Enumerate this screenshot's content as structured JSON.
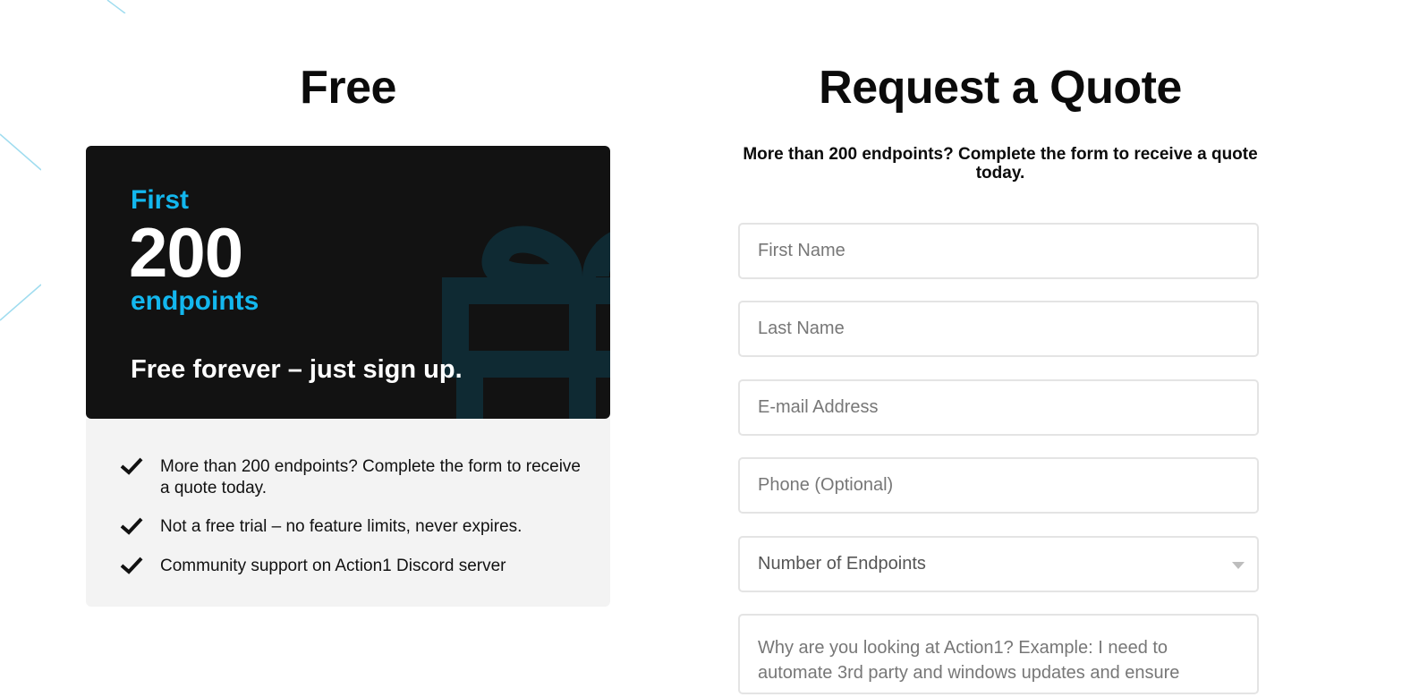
{
  "free": {
    "title": "Free",
    "promo": {
      "first": "First",
      "number": "200",
      "unit": "endpoints",
      "tagline": "Free forever – just sign up."
    },
    "features": [
      "More than 200 endpoints? Complete the form to receive a quote today.",
      "Not a free trial – no feature limits, never expires.",
      "Community support on Action1 Discord server"
    ]
  },
  "quote": {
    "title": "Request a Quote",
    "subtitle": "More than 200 endpoints? Complete the form to receive a quote today.",
    "fields": {
      "first_name": "First Name",
      "last_name": "Last Name",
      "email": "E-mail Address",
      "phone": "Phone (Optional)",
      "endpoints": "Number of Endpoints",
      "reason": "Why are you looking at Action1? Example: I need to automate 3rd party and windows updates and ensure"
    }
  },
  "colors": {
    "accent": "#13b7ee",
    "promo_bg": "#121212",
    "gift": "#0f2a33"
  },
  "icons": {
    "check": "check-icon",
    "gift": "gift-icon",
    "dropdown": "chevron-down-icon"
  }
}
